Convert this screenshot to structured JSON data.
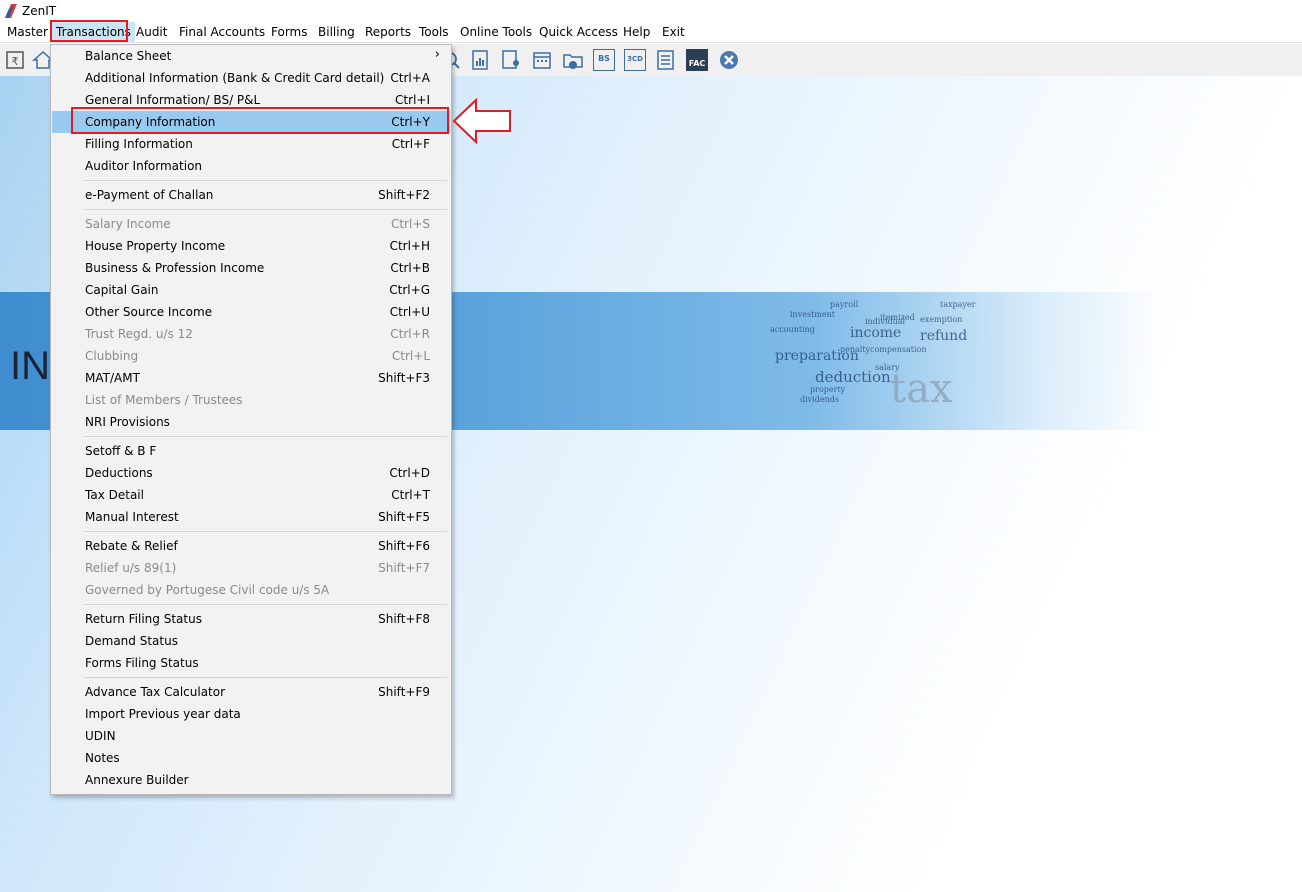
{
  "app": {
    "title": "ZenIT",
    "logo_icon": "zenit-logo-icon"
  },
  "menubar": {
    "items": [
      {
        "label": "Master"
      },
      {
        "label": "Transactions"
      },
      {
        "label": "Audit"
      },
      {
        "label": "Final Accounts"
      },
      {
        "label": "Forms"
      },
      {
        "label": "Billing"
      },
      {
        "label": "Reports"
      },
      {
        "label": "Tools"
      },
      {
        "label": "Online Tools"
      },
      {
        "label": "Quick Access"
      },
      {
        "label": "Help"
      },
      {
        "label": "Exit"
      }
    ],
    "active": "Transactions",
    "highlight_color": "#e31b23"
  },
  "toolbar": {
    "icons": [
      "rupee-book-icon",
      "home-icon",
      "search-document-icon",
      "calculator-report-icon",
      "user-document-icon",
      "calendar-icon",
      "folder-add-icon",
      "bs-icon",
      "3cd-icon",
      "report-list-icon",
      "fac-icon",
      "close-circle-icon"
    ],
    "bs_label": "BS",
    "cd_label": "3CD",
    "fac_label": "FAC"
  },
  "banner": {
    "text": "INC",
    "words": [
      "payroll",
      "taxpayer",
      "investment",
      "itemized",
      "accounting",
      "income",
      "refund",
      "individual",
      "preparation",
      "deduction",
      "tax",
      "dividends",
      "salary",
      "property",
      "compensation",
      "exemption",
      "penalty"
    ]
  },
  "dropdown": {
    "items": [
      {
        "label": "Balance Sheet",
        "shortcut": "",
        "submenu": true
      },
      {
        "label": "Additional Information (Bank & Credit Card detail)",
        "shortcut": "Ctrl+A"
      },
      {
        "label": "General Information/ BS/ P&L",
        "shortcut": "Ctrl+I"
      },
      {
        "label": "Company Information",
        "shortcut": "Ctrl+Y",
        "selected": true
      },
      {
        "label": "Filling Information",
        "shortcut": "Ctrl+F"
      },
      {
        "label": "Auditor Information",
        "shortcut": ""
      },
      {
        "label": "e-Payment of Challan",
        "shortcut": "Shift+F2"
      },
      {
        "label": "Salary Income",
        "shortcut": "Ctrl+S",
        "disabled": true
      },
      {
        "label": "House Property Income",
        "shortcut": "Ctrl+H"
      },
      {
        "label": "Business & Profession Income",
        "shortcut": "Ctrl+B"
      },
      {
        "label": "Capital Gain",
        "shortcut": "Ctrl+G"
      },
      {
        "label": "Other Source Income",
        "shortcut": "Ctrl+U"
      },
      {
        "label": "Trust Regd. u/s 12",
        "shortcut": "Ctrl+R",
        "disabled": true
      },
      {
        "label": "Clubbing",
        "shortcut": "Ctrl+L",
        "disabled": true
      },
      {
        "label": "MAT/AMT",
        "shortcut": "Shift+F3"
      },
      {
        "label": "List of Members / Trustees",
        "shortcut": "",
        "disabled": true
      },
      {
        "label": "NRI Provisions",
        "shortcut": ""
      },
      {
        "label": "Setoff & B F",
        "shortcut": ""
      },
      {
        "label": "Deductions",
        "shortcut": "Ctrl+D"
      },
      {
        "label": "Tax Detail",
        "shortcut": "Ctrl+T"
      },
      {
        "label": "Manual Interest",
        "shortcut": "Shift+F5"
      },
      {
        "label": "Rebate & Relief",
        "shortcut": "Shift+F6"
      },
      {
        "label": "Relief u/s 89(1)",
        "shortcut": "Shift+F7",
        "disabled": true
      },
      {
        "label": "Governed by Portugese Civil code u/s 5A",
        "shortcut": "",
        "disabled": true
      },
      {
        "label": "Return Filing Status",
        "shortcut": "Shift+F8"
      },
      {
        "label": "Demand Status",
        "shortcut": ""
      },
      {
        "label": "Forms Filing Status",
        "shortcut": ""
      },
      {
        "label": "Advance Tax Calculator",
        "shortcut": "Shift+F9"
      },
      {
        "label": "Import Previous year data",
        "shortcut": ""
      },
      {
        "label": "UDIN",
        "shortcut": ""
      },
      {
        "label": "Notes",
        "shortcut": ""
      },
      {
        "label": "Annexure Builder",
        "shortcut": ""
      }
    ],
    "submenu_icon": "chevron-right-icon",
    "callout_icon": "left-arrow-icon"
  }
}
